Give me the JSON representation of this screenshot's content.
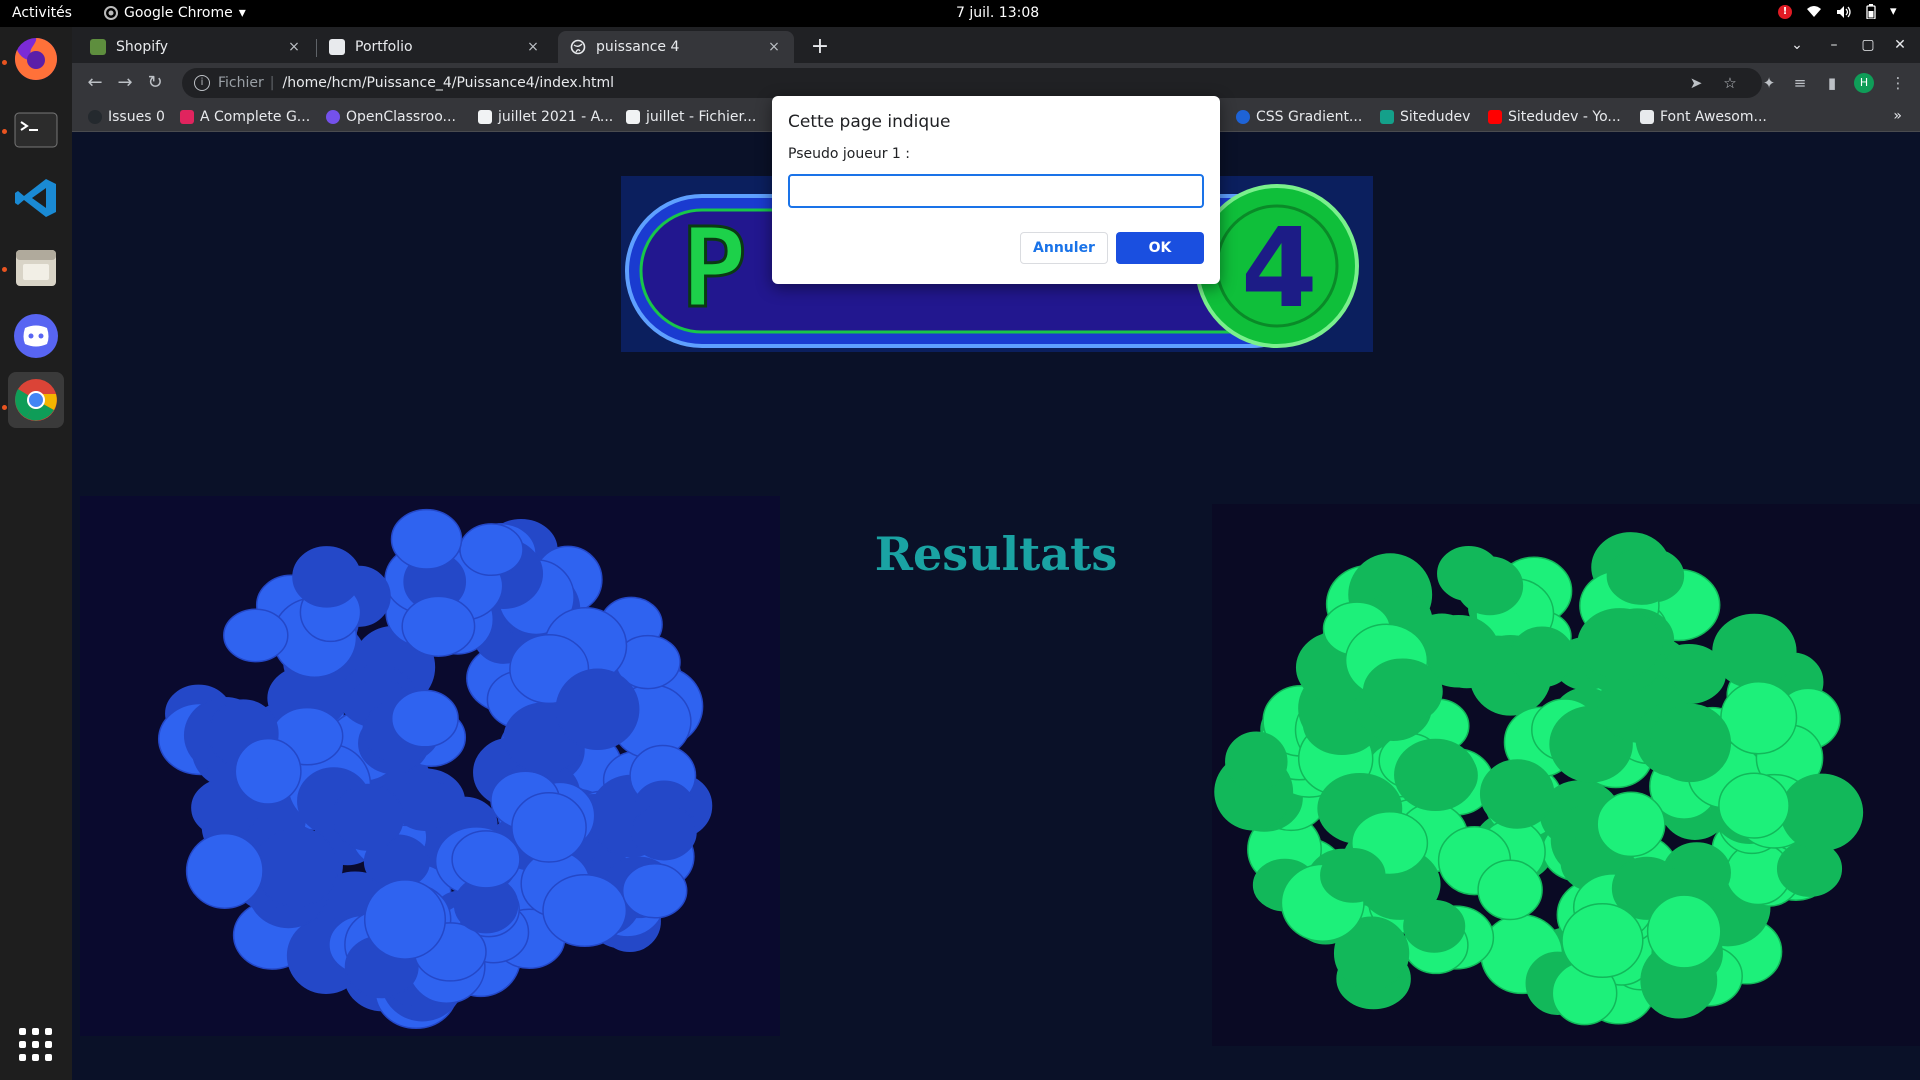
{
  "system": {
    "activities": "Activités",
    "app_name": "Google Chrome",
    "clock": "7 juil.  13:08",
    "tray": [
      "alert-icon",
      "wifi-icon",
      "volume-icon",
      "battery-icon",
      "chevron-down-icon"
    ]
  },
  "dock": [
    "firefox-icon",
    "terminal-icon",
    "vscode-icon",
    "files-icon",
    "discord-icon",
    "chrome-icon",
    "app-grid-icon"
  ],
  "tabs": [
    {
      "title": "Shopify",
      "close": "×",
      "color": "#5e8e3e"
    },
    {
      "title": "Portfolio",
      "close": "×",
      "color": "#bdc1c6"
    },
    {
      "title": "puissance 4",
      "close": "×",
      "color": "#bdc1c6"
    }
  ],
  "new_tab": "+",
  "window_controls": {
    "tablist": "⌄",
    "minimize": "–",
    "maximize": "▢",
    "close": "✕"
  },
  "address": {
    "scheme": "Fichier",
    "separator": "|",
    "url": "/home/hcm/Puissance_4/Puissance4/index.html"
  },
  "bookmarks": [
    {
      "label": "Issues 0",
      "color": "#24292e"
    },
    {
      "label": "A Complete G...",
      "color": "#e0245e"
    },
    {
      "label": "OpenClassroo...",
      "color": "#7451eb"
    },
    {
      "label": "juillet 2021 - A...",
      "color": "#f1f3f4"
    },
    {
      "label": "juillet - Fichier...",
      "color": "#f1f3f4"
    },
    {
      "label": "CSS Gradient...",
      "color": "#1e63d6"
    },
    {
      "label": "Sitedudev",
      "color": "#14a08a"
    },
    {
      "label": "Sitedudev - Yo...",
      "color": "#ff0000"
    },
    {
      "label": "Font Awesom...",
      "color": "#e8eaed"
    }
  ],
  "bookmarks_more": "»",
  "page": {
    "results_title": "Resultats",
    "colors": {
      "blue_token": "#2f63f0",
      "green_token": "#1df07a",
      "title": "#1aa3a3"
    }
  },
  "dialog": {
    "title": "Cette page indique",
    "message": "Pseudo joueur 1 :",
    "input_value": "",
    "cancel_label": "Annuler",
    "ok_label": "OK"
  }
}
